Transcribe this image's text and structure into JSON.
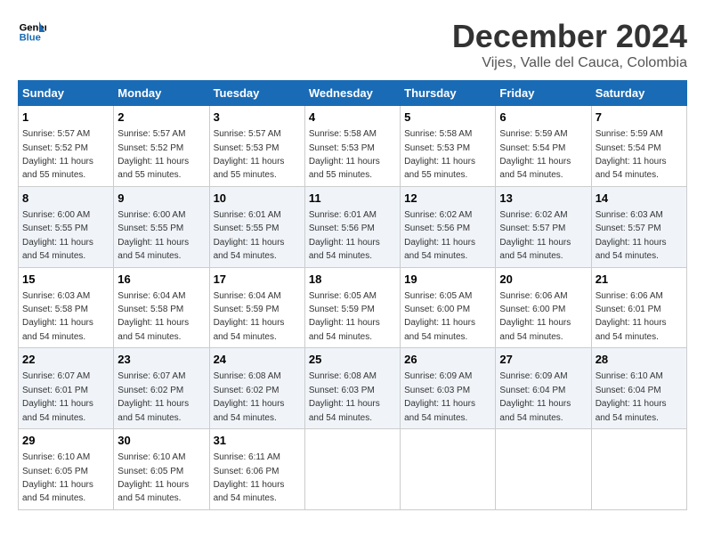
{
  "logo": {
    "line1": "General",
    "line2": "Blue"
  },
  "title": "December 2024",
  "subtitle": "Vijes, Valle del Cauca, Colombia",
  "weekdays": [
    "Sunday",
    "Monday",
    "Tuesday",
    "Wednesday",
    "Thursday",
    "Friday",
    "Saturday"
  ],
  "weeks": [
    [
      {
        "day": "1",
        "sunrise": "Sunrise: 5:57 AM",
        "sunset": "Sunset: 5:52 PM",
        "daylight": "Daylight: 11 hours and 55 minutes."
      },
      {
        "day": "2",
        "sunrise": "Sunrise: 5:57 AM",
        "sunset": "Sunset: 5:52 PM",
        "daylight": "Daylight: 11 hours and 55 minutes."
      },
      {
        "day": "3",
        "sunrise": "Sunrise: 5:57 AM",
        "sunset": "Sunset: 5:53 PM",
        "daylight": "Daylight: 11 hours and 55 minutes."
      },
      {
        "day": "4",
        "sunrise": "Sunrise: 5:58 AM",
        "sunset": "Sunset: 5:53 PM",
        "daylight": "Daylight: 11 hours and 55 minutes."
      },
      {
        "day": "5",
        "sunrise": "Sunrise: 5:58 AM",
        "sunset": "Sunset: 5:53 PM",
        "daylight": "Daylight: 11 hours and 55 minutes."
      },
      {
        "day": "6",
        "sunrise": "Sunrise: 5:59 AM",
        "sunset": "Sunset: 5:54 PM",
        "daylight": "Daylight: 11 hours and 54 minutes."
      },
      {
        "day": "7",
        "sunrise": "Sunrise: 5:59 AM",
        "sunset": "Sunset: 5:54 PM",
        "daylight": "Daylight: 11 hours and 54 minutes."
      }
    ],
    [
      {
        "day": "8",
        "sunrise": "Sunrise: 6:00 AM",
        "sunset": "Sunset: 5:55 PM",
        "daylight": "Daylight: 11 hours and 54 minutes."
      },
      {
        "day": "9",
        "sunrise": "Sunrise: 6:00 AM",
        "sunset": "Sunset: 5:55 PM",
        "daylight": "Daylight: 11 hours and 54 minutes."
      },
      {
        "day": "10",
        "sunrise": "Sunrise: 6:01 AM",
        "sunset": "Sunset: 5:55 PM",
        "daylight": "Daylight: 11 hours and 54 minutes."
      },
      {
        "day": "11",
        "sunrise": "Sunrise: 6:01 AM",
        "sunset": "Sunset: 5:56 PM",
        "daylight": "Daylight: 11 hours and 54 minutes."
      },
      {
        "day": "12",
        "sunrise": "Sunrise: 6:02 AM",
        "sunset": "Sunset: 5:56 PM",
        "daylight": "Daylight: 11 hours and 54 minutes."
      },
      {
        "day": "13",
        "sunrise": "Sunrise: 6:02 AM",
        "sunset": "Sunset: 5:57 PM",
        "daylight": "Daylight: 11 hours and 54 minutes."
      },
      {
        "day": "14",
        "sunrise": "Sunrise: 6:03 AM",
        "sunset": "Sunset: 5:57 PM",
        "daylight": "Daylight: 11 hours and 54 minutes."
      }
    ],
    [
      {
        "day": "15",
        "sunrise": "Sunrise: 6:03 AM",
        "sunset": "Sunset: 5:58 PM",
        "daylight": "Daylight: 11 hours and 54 minutes."
      },
      {
        "day": "16",
        "sunrise": "Sunrise: 6:04 AM",
        "sunset": "Sunset: 5:58 PM",
        "daylight": "Daylight: 11 hours and 54 minutes."
      },
      {
        "day": "17",
        "sunrise": "Sunrise: 6:04 AM",
        "sunset": "Sunset: 5:59 PM",
        "daylight": "Daylight: 11 hours and 54 minutes."
      },
      {
        "day": "18",
        "sunrise": "Sunrise: 6:05 AM",
        "sunset": "Sunset: 5:59 PM",
        "daylight": "Daylight: 11 hours and 54 minutes."
      },
      {
        "day": "19",
        "sunrise": "Sunrise: 6:05 AM",
        "sunset": "Sunset: 6:00 PM",
        "daylight": "Daylight: 11 hours and 54 minutes."
      },
      {
        "day": "20",
        "sunrise": "Sunrise: 6:06 AM",
        "sunset": "Sunset: 6:00 PM",
        "daylight": "Daylight: 11 hours and 54 minutes."
      },
      {
        "day": "21",
        "sunrise": "Sunrise: 6:06 AM",
        "sunset": "Sunset: 6:01 PM",
        "daylight": "Daylight: 11 hours and 54 minutes."
      }
    ],
    [
      {
        "day": "22",
        "sunrise": "Sunrise: 6:07 AM",
        "sunset": "Sunset: 6:01 PM",
        "daylight": "Daylight: 11 hours and 54 minutes."
      },
      {
        "day": "23",
        "sunrise": "Sunrise: 6:07 AM",
        "sunset": "Sunset: 6:02 PM",
        "daylight": "Daylight: 11 hours and 54 minutes."
      },
      {
        "day": "24",
        "sunrise": "Sunrise: 6:08 AM",
        "sunset": "Sunset: 6:02 PM",
        "daylight": "Daylight: 11 hours and 54 minutes."
      },
      {
        "day": "25",
        "sunrise": "Sunrise: 6:08 AM",
        "sunset": "Sunset: 6:03 PM",
        "daylight": "Daylight: 11 hours and 54 minutes."
      },
      {
        "day": "26",
        "sunrise": "Sunrise: 6:09 AM",
        "sunset": "Sunset: 6:03 PM",
        "daylight": "Daylight: 11 hours and 54 minutes."
      },
      {
        "day": "27",
        "sunrise": "Sunrise: 6:09 AM",
        "sunset": "Sunset: 6:04 PM",
        "daylight": "Daylight: 11 hours and 54 minutes."
      },
      {
        "day": "28",
        "sunrise": "Sunrise: 6:10 AM",
        "sunset": "Sunset: 6:04 PM",
        "daylight": "Daylight: 11 hours and 54 minutes."
      }
    ],
    [
      {
        "day": "29",
        "sunrise": "Sunrise: 6:10 AM",
        "sunset": "Sunset: 6:05 PM",
        "daylight": "Daylight: 11 hours and 54 minutes."
      },
      {
        "day": "30",
        "sunrise": "Sunrise: 6:10 AM",
        "sunset": "Sunset: 6:05 PM",
        "daylight": "Daylight: 11 hours and 54 minutes."
      },
      {
        "day": "31",
        "sunrise": "Sunrise: 6:11 AM",
        "sunset": "Sunset: 6:06 PM",
        "daylight": "Daylight: 11 hours and 54 minutes."
      },
      null,
      null,
      null,
      null
    ]
  ]
}
